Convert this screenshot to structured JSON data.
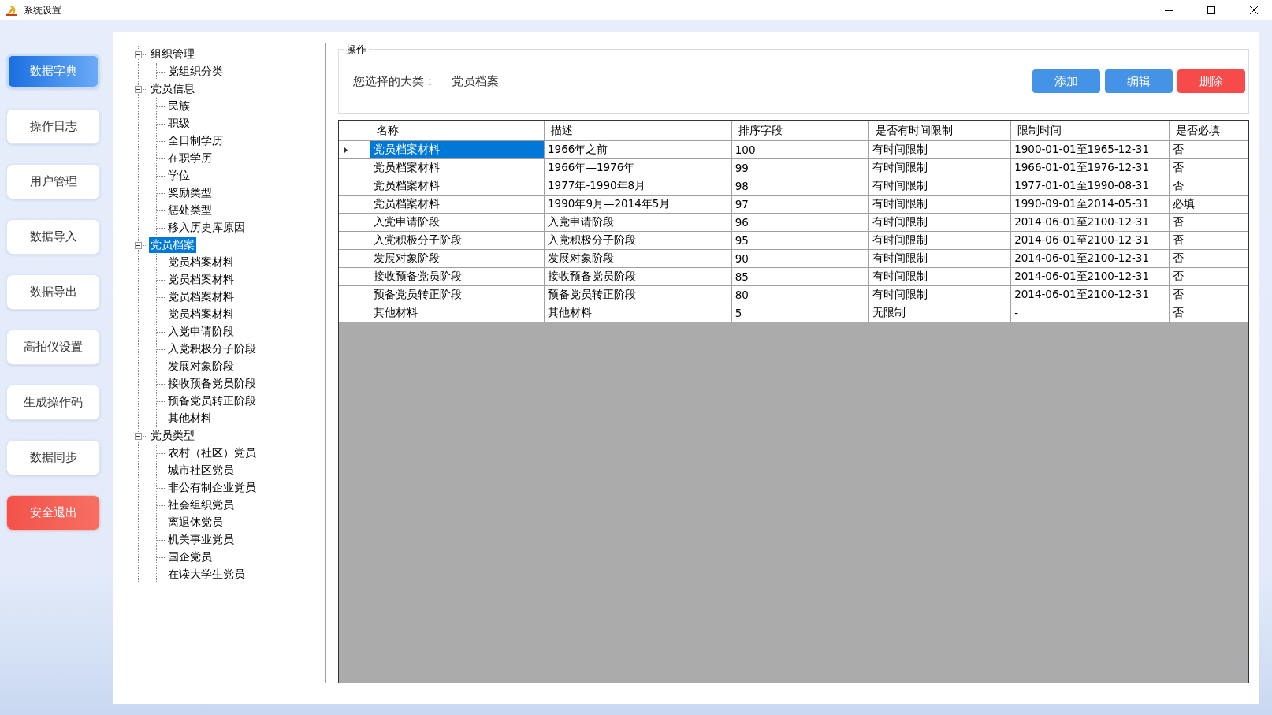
{
  "window": {
    "title": "系统设置"
  },
  "sidebar": {
    "items": [
      {
        "label": "数据字典",
        "selected": true,
        "kind": "normal"
      },
      {
        "label": "操作日志",
        "selected": false,
        "kind": "normal"
      },
      {
        "label": "用户管理",
        "selected": false,
        "kind": "normal"
      },
      {
        "label": "数据导入",
        "selected": false,
        "kind": "normal"
      },
      {
        "label": "数据导出",
        "selected": false,
        "kind": "normal"
      },
      {
        "label": "高拍仪设置",
        "selected": false,
        "kind": "normal"
      },
      {
        "label": "生成操作码",
        "selected": false,
        "kind": "normal"
      },
      {
        "label": "数据同步",
        "selected": false,
        "kind": "normal"
      },
      {
        "label": "安全退出",
        "selected": false,
        "kind": "danger"
      }
    ]
  },
  "tree": {
    "nodes": [
      {
        "label": "组织管理",
        "expanded": true,
        "selected": false,
        "children": [
          {
            "label": "党组织分类",
            "selected": false
          }
        ]
      },
      {
        "label": "党员信息",
        "expanded": true,
        "selected": false,
        "children": [
          {
            "label": "民族",
            "selected": false
          },
          {
            "label": "职级",
            "selected": false
          },
          {
            "label": "全日制学历",
            "selected": false
          },
          {
            "label": "在职学历",
            "selected": false
          },
          {
            "label": "学位",
            "selected": false
          },
          {
            "label": "奖励类型",
            "selected": false
          },
          {
            "label": "惩处类型",
            "selected": false
          },
          {
            "label": "移入历史库原因",
            "selected": false
          }
        ]
      },
      {
        "label": "党员档案",
        "expanded": true,
        "selected": true,
        "children": [
          {
            "label": "党员档案材料",
            "selected": false
          },
          {
            "label": "党员档案材料",
            "selected": false
          },
          {
            "label": "党员档案材料",
            "selected": false
          },
          {
            "label": "党员档案材料",
            "selected": false
          },
          {
            "label": "入党申请阶段",
            "selected": false
          },
          {
            "label": "入党积极分子阶段",
            "selected": false
          },
          {
            "label": "发展对象阶段",
            "selected": false
          },
          {
            "label": "接收预备党员阶段",
            "selected": false
          },
          {
            "label": "预备党员转正阶段",
            "selected": false
          },
          {
            "label": "其他材料",
            "selected": false
          }
        ]
      },
      {
        "label": "党员类型",
        "expanded": true,
        "selected": false,
        "children": [
          {
            "label": "农村（社区）党员",
            "selected": false
          },
          {
            "label": "城市社区党员",
            "selected": false
          },
          {
            "label": "非公有制企业党员",
            "selected": false
          },
          {
            "label": "社会组织党员",
            "selected": false
          },
          {
            "label": "离退休党员",
            "selected": false
          },
          {
            "label": "机关事业党员",
            "selected": false
          },
          {
            "label": "国企党员",
            "selected": false
          },
          {
            "label": "在读大学生党员",
            "selected": false
          }
        ]
      }
    ]
  },
  "operation": {
    "title": "操作",
    "label": "您选择的大类：",
    "value": "党员档案",
    "buttons": [
      {
        "label": "添加",
        "kind": "primary"
      },
      {
        "label": "编辑",
        "kind": "primary"
      },
      {
        "label": "删除",
        "kind": "danger"
      }
    ]
  },
  "table": {
    "columns": [
      "名称",
      "描述",
      "排序字段",
      "是否有时间限制",
      "限制时间",
      "是否必填"
    ],
    "rows": [
      {
        "selected": true,
        "cells": [
          "党员档案材料",
          "1966年之前",
          "100",
          "有时间限制",
          "1900-01-01至1965-12-31",
          "否"
        ]
      },
      {
        "selected": false,
        "cells": [
          "党员档案材料",
          "1966年—1976年",
          "99",
          "有时间限制",
          "1966-01-01至1976-12-31",
          "否"
        ]
      },
      {
        "selected": false,
        "cells": [
          "党员档案材料",
          "1977年-1990年8月",
          "98",
          "有时间限制",
          "1977-01-01至1990-08-31",
          "否"
        ]
      },
      {
        "selected": false,
        "cells": [
          "党员档案材料",
          "1990年9月—2014年5月",
          "97",
          "有时间限制",
          "1990-09-01至2014-05-31",
          "必填"
        ]
      },
      {
        "selected": false,
        "cells": [
          "入党申请阶段",
          "入党申请阶段",
          "96",
          "有时间限制",
          "2014-06-01至2100-12-31",
          "否"
        ]
      },
      {
        "selected": false,
        "cells": [
          "入党积极分子阶段",
          "入党积极分子阶段",
          "95",
          "有时间限制",
          "2014-06-01至2100-12-31",
          "否"
        ]
      },
      {
        "selected": false,
        "cells": [
          "发展对象阶段",
          "发展对象阶段",
          "90",
          "有时间限制",
          "2014-06-01至2100-12-31",
          "否"
        ]
      },
      {
        "selected": false,
        "cells": [
          "接收预备党员阶段",
          "接收预备党员阶段",
          "85",
          "有时间限制",
          "2014-06-01至2100-12-31",
          "否"
        ]
      },
      {
        "selected": false,
        "cells": [
          "预备党员转正阶段",
          "预备党员转正阶段",
          "80",
          "有时间限制",
          "2014-06-01至2100-12-31",
          "否"
        ]
      },
      {
        "selected": false,
        "cells": [
          "其他材料",
          "其他材料",
          "5",
          "无限制",
          "-",
          "否"
        ]
      }
    ]
  }
}
